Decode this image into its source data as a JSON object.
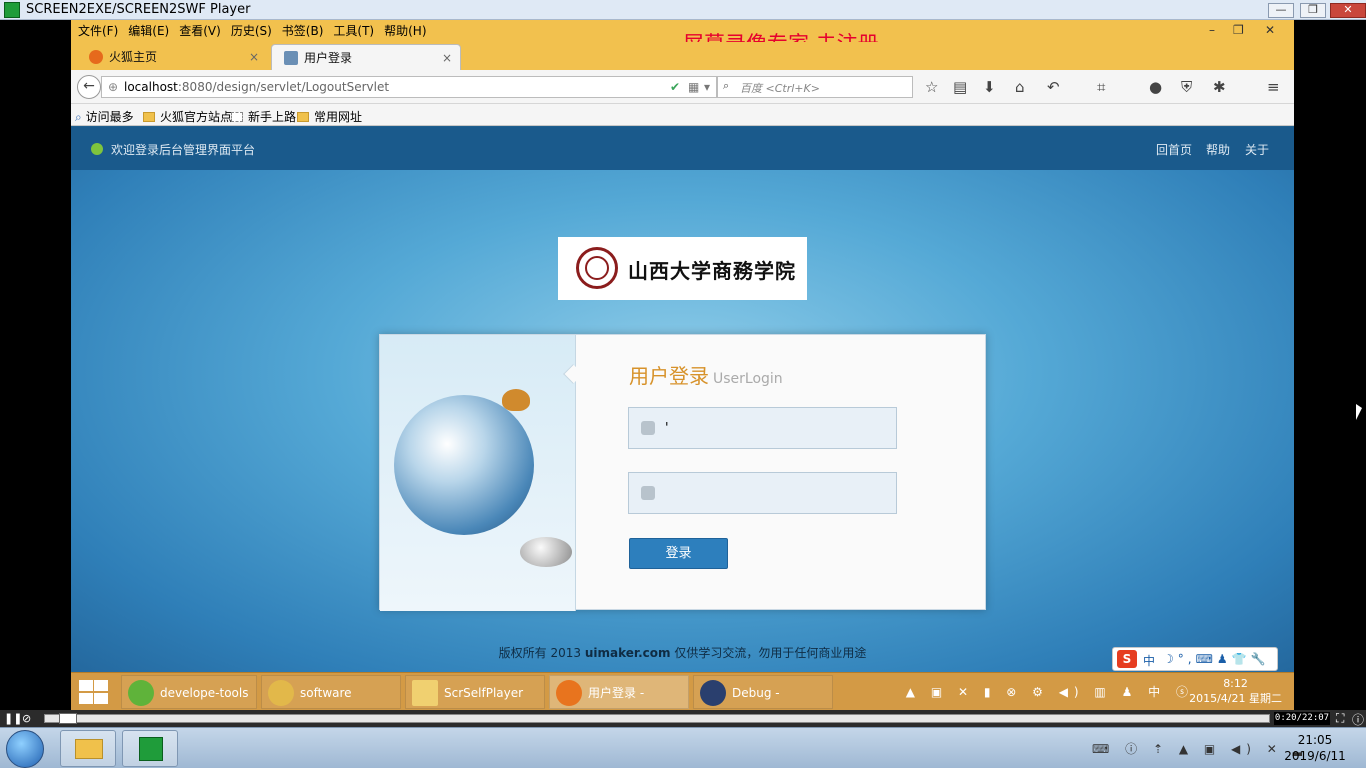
{
  "player": {
    "title": "SCREEN2EXE/SCREEN2SWF Player",
    "minimize": "—",
    "restore": "❐",
    "close": "✕",
    "time": "0:20/22:07",
    "play_glyph": "❚❚"
  },
  "firefox": {
    "menu": [
      "文件(F)",
      "编辑(E)",
      "查看(V)",
      "历史(S)",
      "书签(B)",
      "工具(T)",
      "帮助(H)"
    ],
    "watermark": "屏幕录像专家  未注册",
    "win_min": "–",
    "win_restore": "❐",
    "win_close": "✕",
    "tabs": [
      {
        "label": "火狐主页"
      },
      {
        "label": "用户登录"
      }
    ],
    "tab_close": "×",
    "new_tab": "+",
    "url_host": "localhost",
    "url_path": ":8080/design/servlet/LogoutServlet",
    "search_placeholder": "百度 <Ctrl+K>",
    "bookmarks": [
      "访问最多",
      "火狐官方站点",
      "新手上路",
      "常用网址"
    ],
    "toolbar_icons": [
      "bookmark-star-icon",
      "reader-icon",
      "download-icon",
      "home-icon",
      "undo-icon",
      "crop-icon",
      "chat-icon",
      "shield-icon",
      "addon-icon",
      "menu-icon"
    ]
  },
  "page": {
    "welcome": "欢迎登录后台管理界面平台",
    "links": [
      "回首页",
      "帮助",
      "关于"
    ],
    "logo_name": "山西大学商務学院",
    "login_title": "用户登录",
    "login_title_en": "UserLogin",
    "username_value": "'",
    "password_value": "",
    "login_button": "登录",
    "copyright_pre": "版权所有 2013 ",
    "copyright_site": "uimaker.com",
    "copyright_post": " 仅供学习交流，勿用于任何商业用途",
    "ime_s": "S",
    "ime_zh": "中",
    "ime_rest": "☽°,⌨♟👕🔧"
  },
  "inner_taskbar": {
    "items": [
      "develope-tools",
      "software",
      "ScrSelfPlayer",
      "用户登录 - Mozil...",
      "Debug - MyEcli..."
    ],
    "tray_lang": "中",
    "time": "8:12",
    "date": "2015/4/21 星期二"
  },
  "host_taskbar": {
    "time": "21:05",
    "date": "2019/6/11"
  }
}
